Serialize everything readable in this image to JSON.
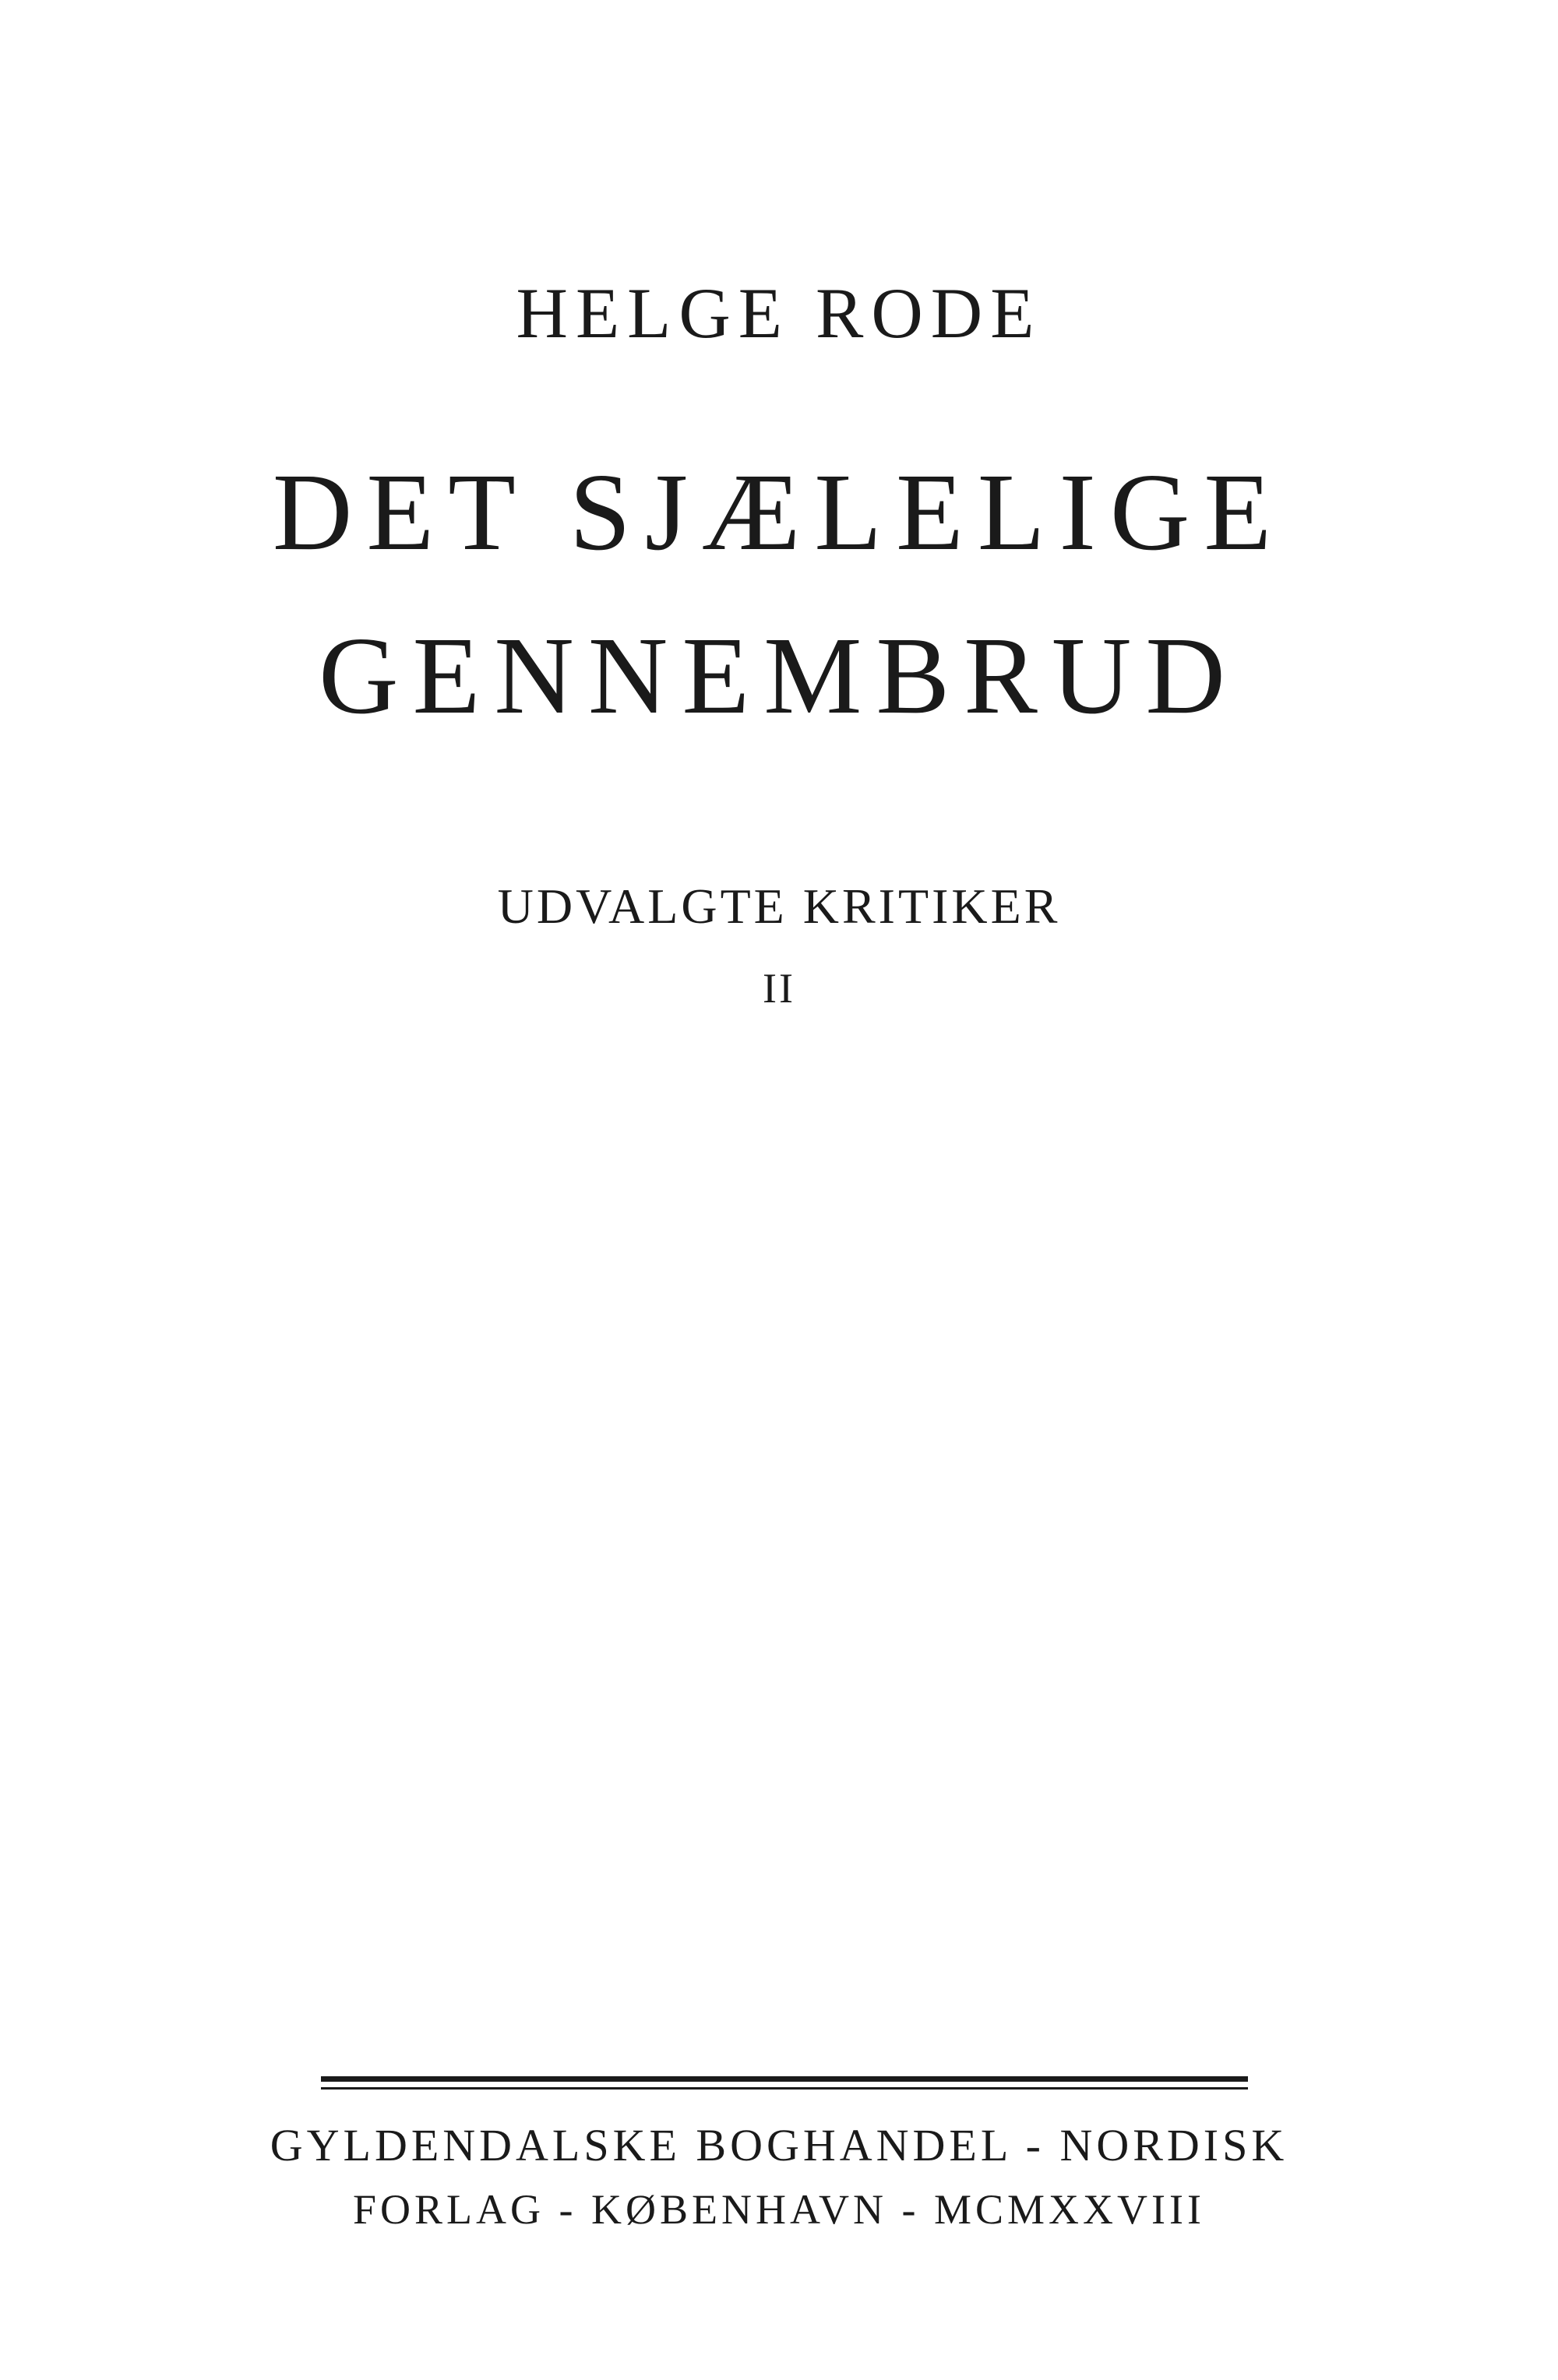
{
  "title_page": {
    "author": "HELGE RODE",
    "title_line_1": "DET SJÆLELIGE",
    "title_line_2": "GENNEMBRUD",
    "subtitle": "UDVALGTE KRITIKER",
    "volume": "II",
    "publisher_line_1": "GYLDENDALSKE BOGHANDEL - NORDISK",
    "publisher_line_2": "FORLAG - KØBENHAVN - MCMXXVIII"
  }
}
